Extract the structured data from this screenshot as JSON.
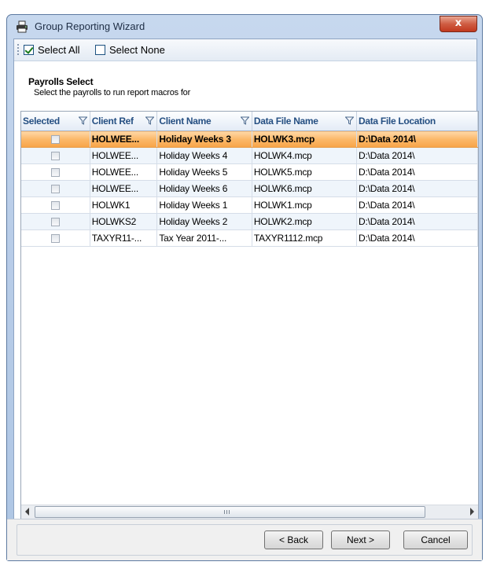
{
  "window": {
    "title": "Group Reporting Wizard",
    "close_label": "x"
  },
  "toolbar": {
    "select_all": {
      "label": "Select All",
      "checked": true
    },
    "select_none": {
      "label": "Select None",
      "checked": false
    }
  },
  "section": {
    "title": "Payrolls Select",
    "subtitle": "Select the payrolls to run report macros for"
  },
  "grid": {
    "columns": [
      "Selected",
      "Client Ref",
      "Client Name",
      "Data File Name",
      "Data File Location"
    ],
    "rows": [
      {
        "selected": false,
        "client_ref": "HOLWEE...",
        "client_name": "Holiday Weeks 3",
        "data_file_name": "HOLWK3.mcp",
        "data_file_location": "D:\\Data 2014\\",
        "highlighted": true
      },
      {
        "selected": false,
        "client_ref": "HOLWEE...",
        "client_name": "Holiday Weeks 4",
        "data_file_name": "HOLWK4.mcp",
        "data_file_location": "D:\\Data 2014\\"
      },
      {
        "selected": false,
        "client_ref": "HOLWEE...",
        "client_name": "Holiday Weeks 5",
        "data_file_name": "HOLWK5.mcp",
        "data_file_location": "D:\\Data 2014\\"
      },
      {
        "selected": false,
        "client_ref": "HOLWEE...",
        "client_name": "Holiday Weeks 6",
        "data_file_name": "HOLWK6.mcp",
        "data_file_location": "D:\\Data 2014\\"
      },
      {
        "selected": false,
        "client_ref": "HOLWK1",
        "client_name": "Holiday Weeks 1",
        "data_file_name": "HOLWK1.mcp",
        "data_file_location": "D:\\Data 2014\\"
      },
      {
        "selected": false,
        "client_ref": "HOLWKS2",
        "client_name": "Holiday Weeks 2",
        "data_file_name": "HOLWK2.mcp",
        "data_file_location": "D:\\Data 2014\\"
      },
      {
        "selected": false,
        "client_ref": "TAXYR11-...",
        "client_name": "Tax Year 2011-...",
        "data_file_name": "TAXYR1112.mcp",
        "data_file_location": "D:\\Data 2014\\"
      }
    ]
  },
  "buttons": {
    "back": "< Back",
    "next": "Next >",
    "cancel": "Cancel"
  },
  "colors": {
    "highlight_row": "#fbb868",
    "header_text": "#254f82",
    "alt_row": "#eff5fb"
  }
}
